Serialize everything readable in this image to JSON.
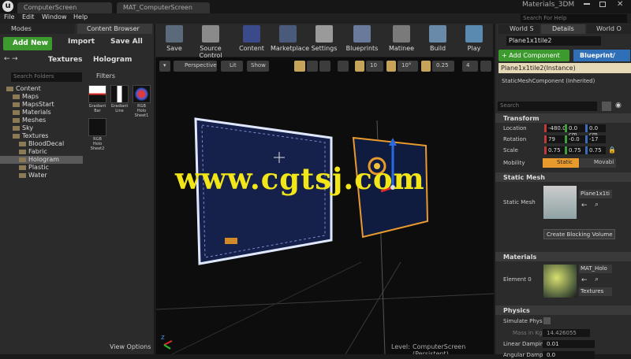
{
  "window": {
    "logo": "u",
    "tabs": [
      "ComputerScreen",
      "MAT_ComputerScreen"
    ],
    "title": "Materials_3DM",
    "search_help_placeholder": "Search For Help"
  },
  "menu": [
    "File",
    "Edit",
    "Window",
    "Help"
  ],
  "left_tabs": [
    "Modes",
    "Content Browser"
  ],
  "content_browser": {
    "add_new_label": "Add New",
    "import_label": "Import",
    "save_all_label": "Save All",
    "path": [
      "Textures",
      "Hologram"
    ],
    "search_folders_placeholder": "Search Folders",
    "filters_label": "Filters",
    "folders": [
      {
        "label": "Content",
        "level": 0
      },
      {
        "label": "Maps",
        "level": 1
      },
      {
        "label": "MapsStart",
        "level": 1
      },
      {
        "label": "Materials",
        "level": 1
      },
      {
        "label": "Meshes",
        "level": 1
      },
      {
        "label": "Sky",
        "level": 1
      },
      {
        "label": "Textures",
        "level": 1
      },
      {
        "label": "BloodDecal",
        "level": 2
      },
      {
        "label": "Fabric",
        "level": 2
      },
      {
        "label": "Hologram",
        "level": 2,
        "selected": true
      },
      {
        "label": "Plastic",
        "level": 2
      },
      {
        "label": "Water",
        "level": 2
      }
    ],
    "assets": [
      {
        "label": "Gradiant Bar"
      },
      {
        "label": "Gradiant Line"
      },
      {
        "label": "RGB Holo Sheet1"
      },
      {
        "label": "RGB Holo Sheet2"
      }
    ],
    "view_options_label": "View Options"
  },
  "toolbar": [
    {
      "label": "Save",
      "icon": "save-icon",
      "color": "#5a6a7a"
    },
    {
      "label": "Source Control",
      "icon": "source-control-icon",
      "color": "#8a8a8a"
    },
    {
      "label": "Content",
      "icon": "content-icon",
      "color": "#3a4a8a"
    },
    {
      "label": "Marketplace",
      "icon": "marketplace-icon",
      "color": "#4a5a7a"
    },
    {
      "label": "Settings",
      "icon": "gear-icon",
      "color": "#9a9a9a"
    },
    {
      "label": "Blueprints",
      "icon": "blueprint-icon",
      "color": "#6a7a9a"
    },
    {
      "label": "Matinee",
      "icon": "clapper-icon",
      "color": "#7a7a7a"
    },
    {
      "label": "Build",
      "icon": "build-icon",
      "color": "#6a8aaa"
    },
    {
      "label": "Play",
      "icon": "play-icon",
      "color": "#5a8ab0"
    }
  ],
  "viewport": {
    "perspective_label": "Perspective",
    "lit_label": "Lit",
    "show_label": "Show",
    "grid_snap": "10",
    "rot_snap": "10°",
    "scale_snap": "0.25",
    "camera_speed": "4",
    "level_label": "Level:",
    "level_name": "ComputerScreen (Persistent)"
  },
  "watermark": "www.cgtsj.com",
  "right_tabs": [
    "World S",
    "Details",
    "World O"
  ],
  "details": {
    "object_name": "Plane1x1tile2",
    "add_component_label": "+ Add Component",
    "blueprint_label": "Blueprint/",
    "instance_label": "Plane1x1tile2(Instance)",
    "component_label": "StaticMeshComponent (Inherited)",
    "search_placeholder": "Search",
    "transform_label": "Transform",
    "location_label": "Location",
    "location": [
      "-480.0",
      "0.0 cm",
      "0.0 cm"
    ],
    "rotation_label": "Rotation",
    "rotation": [
      "79",
      "-0.0",
      "-17"
    ],
    "scale_label": "Scale",
    "scale": [
      "0.75",
      "0.75",
      "0.75"
    ],
    "mobility_label": "Mobility",
    "static_label": "Static",
    "movable_label": "Movabl",
    "static_mesh_section": "Static Mesh",
    "static_mesh_label": "Static Mesh",
    "mesh_name": "Plane1x1ti",
    "create_collision_label": "Create Blocking Volume",
    "materials_section": "Materials",
    "element_label": "Element 0",
    "material_name": "MAT_Holo",
    "textures_label": "Textures",
    "physics_section": "Physics",
    "simulate_label": "Simulate Phys",
    "mass_label": "Mass in Kg",
    "mass_value": "14.426055",
    "linear_damping_label": "Linear Dampin",
    "linear_damping": "0.01",
    "angular_damping_label": "Angular Dampi",
    "angular_damping": "0.0"
  },
  "colors": {
    "accent_green": "#3d9a2e",
    "accent_blue": "#2e6fb8",
    "watermark": "#f2e619",
    "selection_orange": "#e89a2c"
  }
}
